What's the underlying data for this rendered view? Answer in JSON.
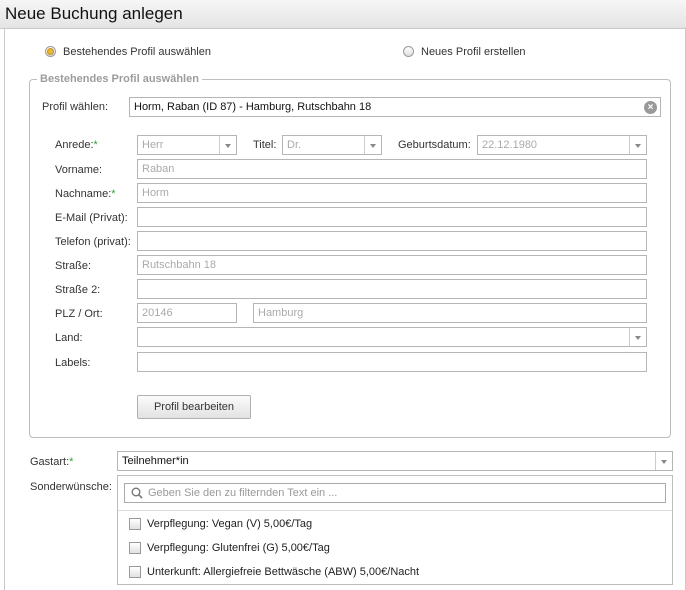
{
  "title": "Neue Buchung anlegen",
  "mode": {
    "existing_label": "Bestehendes Profil auswählen",
    "new_label": "Neues Profil erstellen",
    "selected": "existing"
  },
  "group": {
    "legend": "Bestehendes Profil auswählen",
    "profile_label": "Profil wählen:",
    "profile_value": "Horm, Raban (ID 87) - Hamburg, Rutschbahn 18",
    "clear_glyph": "×"
  },
  "form": {
    "anrede_label": "Anrede:",
    "anrede_value": "Herr",
    "titel_label": "Titel:",
    "titel_value": "Dr.",
    "geburtsdatum_label": "Geburtsdatum:",
    "geburtsdatum_value": "22.12.1980",
    "vorname_label": "Vorname:",
    "vorname_value": "Raban",
    "nachname_label": "Nachname:",
    "nachname_value": "Horm",
    "email_label": "E-Mail (Privat):",
    "email_value": "",
    "telefon_label": "Telefon (privat):",
    "telefon_value": "",
    "strasse_label": "Straße:",
    "strasse_value": "Rutschbahn 18",
    "strasse2_label": "Straße 2:",
    "strasse2_value": "",
    "plz_ort_label": "PLZ / Ort:",
    "plz_value": "20146",
    "ort_value": "Hamburg",
    "land_label": "Land:",
    "land_value": "",
    "labels_label": "Labels:",
    "labels_value": "",
    "edit_button": "Profil bearbeiten",
    "required_mark": "*"
  },
  "gastart": {
    "label": "Gastart:",
    "value": "Teilnehmer*in"
  },
  "sonderwuensche": {
    "label": "Sonderwünsche:",
    "filter_placeholder": "Geben Sie den zu filternden Text ein ...",
    "options": [
      {
        "label": "Verpflegung: Vegan (V) 5,00€/Tag",
        "checked": false
      },
      {
        "label": "Verpflegung: Glutenfrei (G) 5,00€/Tag",
        "checked": false
      },
      {
        "label": "Unterkunft: Allergiefreie Bettwäsche (ABW) 5,00€/Nacht",
        "checked": false
      }
    ]
  },
  "colors": {
    "required": "#2ea53a",
    "radio_selected": "#e9b73a",
    "legend": "#9c9c9c"
  }
}
